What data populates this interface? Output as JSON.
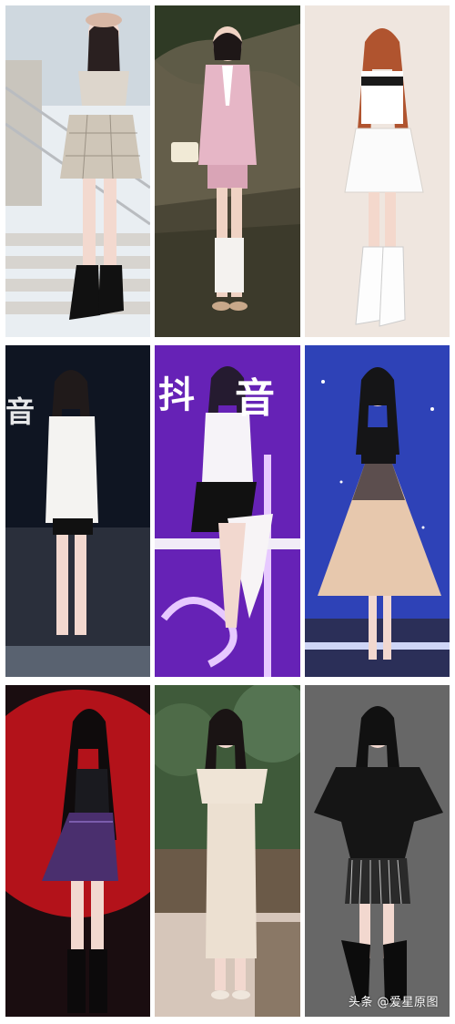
{
  "watermark": "头条 @爱星原图",
  "stage_signs": {
    "cell4": "音",
    "cell5_left": "抖",
    "cell5_right": "音"
  },
  "colors": {
    "page_bg": "#ffffff",
    "row1_bg_left": "#e9eef2",
    "row1_bg_mid": "#4a4636",
    "row1_bg_right": "#efe6df",
    "row2_bg_left": "#1d2433",
    "row2_bg_mid": "#5b1ea8",
    "row2_bg_right": "#3a4fc6",
    "row3_bg_left": "#b3121a",
    "row3_bg_mid": "#5d7b58",
    "row3_bg_right": "#5c5c5c"
  }
}
